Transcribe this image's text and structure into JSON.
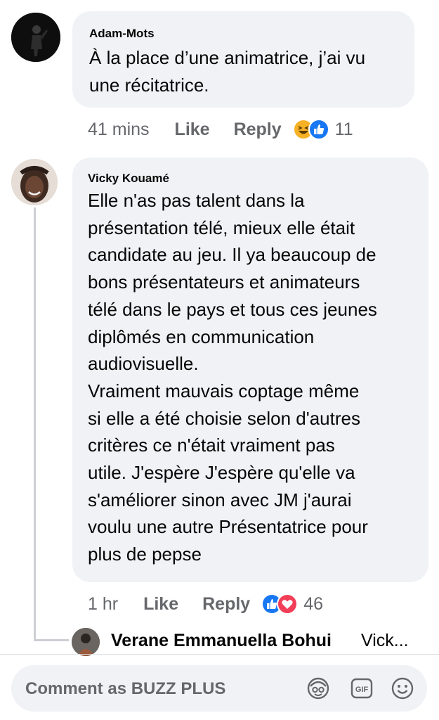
{
  "comments": [
    {
      "author": "Adam-Mots",
      "text": "À la place d’une animatrice, j’ai vu\nune récitatrice.",
      "time": "41 mins",
      "like_label": "Like",
      "reply_label": "Reply",
      "reactions": [
        "haha-icon",
        "like-icon"
      ],
      "reaction_count": "11"
    },
    {
      "author": "Vicky Kouamé",
      "text": "Elle n'as pas talent dans la\nprésentation télé, mieux elle était\ncandidate au jeu. Il ya beaucoup de\nbons présentateurs et animateurs\ntélé dans le pays et tous ces jeunes\ndiplômés en communication\naudiovisuelle.\nVraiment mauvais coptage même\nsi elle a été choisie selon d'autres\ncritères ce n'était vraiment pas\nutile. J'espère J'espère qu'elle va\ns'améliorer sinon avec JM j'aurai\nvoulu une autre Présentatrice pour\nplus de pepse",
      "time": "1 hr",
      "like_label": "Like",
      "reply_label": "Reply",
      "reactions": [
        "like-icon",
        "love-icon"
      ],
      "reaction_count": "46",
      "reply_preview": {
        "author": "Verane Emmanuella Bohui",
        "snippet": "Vick..."
      }
    }
  ],
  "composer": {
    "placeholder": "Comment as BUZZ PLUS",
    "icons": [
      "avatar-sticker-icon",
      "gif-icon",
      "emoji-icon"
    ]
  },
  "colors": {
    "bubble": "#f0f2f5",
    "meta_text": "#65676b",
    "like_blue": "#1877f2",
    "love_red": "#f33e58",
    "haha_yellow": "#f7b125"
  }
}
